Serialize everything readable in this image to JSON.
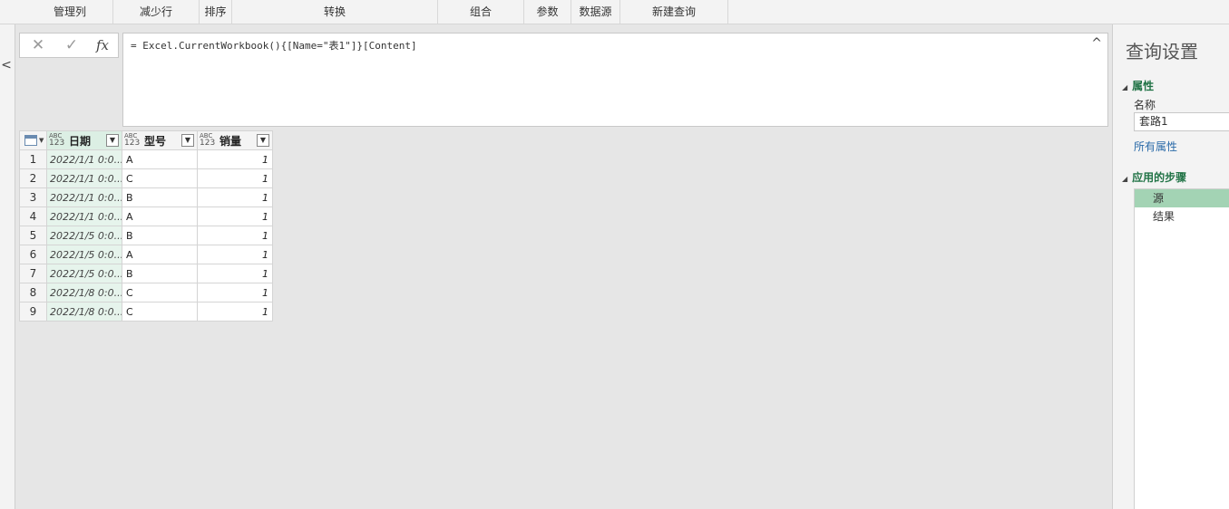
{
  "ribbon": {
    "groups": [
      "管理列",
      "减少行",
      "排序",
      "转换",
      "组合",
      "参数",
      "数据源",
      "新建查询"
    ]
  },
  "formula_bar": {
    "cancel_icon": "✕",
    "confirm_icon": "✓",
    "fx_label": "fx",
    "expression": "= Excel.CurrentWorkbook(){[Name=\"表1\"]}[Content]",
    "expand_icon": "^"
  },
  "table": {
    "type_badge_top": "ABC",
    "type_badge_bottom": "123",
    "columns": [
      "日期",
      "型号",
      "销量"
    ],
    "rows": [
      {
        "n": "1",
        "date": "2022/1/1 0:0...",
        "type": "A",
        "sales": "1"
      },
      {
        "n": "2",
        "date": "2022/1/1 0:0...",
        "type": "C",
        "sales": "1"
      },
      {
        "n": "3",
        "date": "2022/1/1 0:0...",
        "type": "B",
        "sales": "1"
      },
      {
        "n": "4",
        "date": "2022/1/1 0:0...",
        "type": "A",
        "sales": "1"
      },
      {
        "n": "5",
        "date": "2022/1/5 0:0...",
        "type": "B",
        "sales": "1"
      },
      {
        "n": "6",
        "date": "2022/1/5 0:0...",
        "type": "A",
        "sales": "1"
      },
      {
        "n": "7",
        "date": "2022/1/5 0:0...",
        "type": "B",
        "sales": "1"
      },
      {
        "n": "8",
        "date": "2022/1/8 0:0...",
        "type": "C",
        "sales": "1"
      },
      {
        "n": "9",
        "date": "2022/1/8 0:0...",
        "type": "C",
        "sales": "1"
      }
    ]
  },
  "settings": {
    "title": "查询设置",
    "properties_heading": "属性",
    "name_label": "名称",
    "name_value": "套路1",
    "all_properties_link": "所有属性",
    "steps_heading": "应用的步骤",
    "steps": [
      "源",
      "结果"
    ],
    "selected_step": "源"
  },
  "colors": {
    "accent_green": "#217346",
    "selected_step_bg": "#a3d3b4",
    "date_column_bg": "#e6f4ec"
  }
}
